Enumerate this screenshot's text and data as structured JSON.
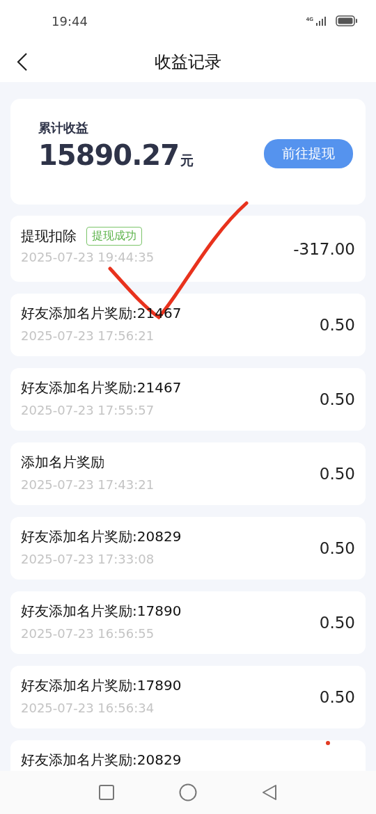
{
  "status_bar": {
    "time": "19:44",
    "network": "4G"
  },
  "header": {
    "title": "收益记录"
  },
  "summary": {
    "label": "累计收益",
    "amount": "15890.27",
    "unit": "元",
    "button": "前往提现"
  },
  "records": [
    {
      "title": "提现扣除",
      "badge": "提现成功",
      "time": "2025-07-23 19:44:35",
      "amount": "-317.00"
    },
    {
      "title": "好友添加名片奖励:21467",
      "time": "2025-07-23 17:56:21",
      "amount": "0.50"
    },
    {
      "title": "好友添加名片奖励:21467",
      "time": "2025-07-23 17:55:57",
      "amount": "0.50"
    },
    {
      "title": "添加名片奖励",
      "time": "2025-07-23 17:43:21",
      "amount": "0.50"
    },
    {
      "title": "好友添加名片奖励:20829",
      "time": "2025-07-23 17:33:08",
      "amount": "0.50"
    },
    {
      "title": "好友添加名片奖励:17890",
      "time": "2025-07-23 16:56:55",
      "amount": "0.50"
    },
    {
      "title": "好友添加名片奖励:17890",
      "time": "2025-07-23 16:56:34",
      "amount": "0.50"
    },
    {
      "title": "好友添加名片奖励:20829"
    }
  ]
}
